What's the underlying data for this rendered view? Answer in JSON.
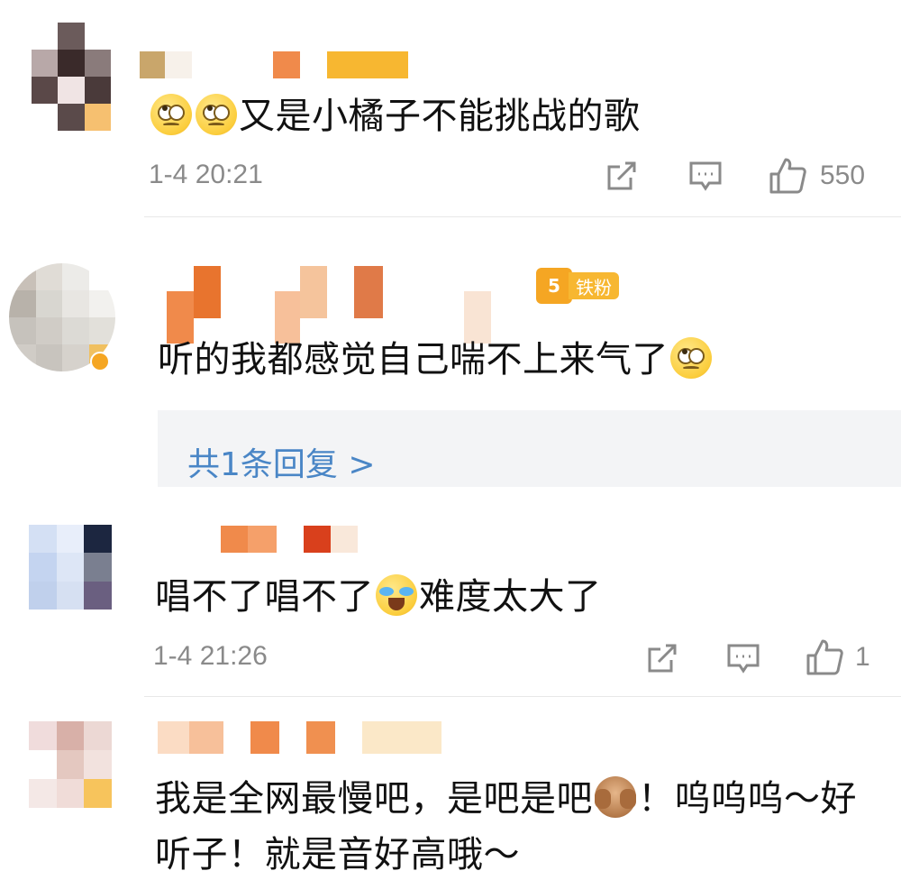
{
  "comments": [
    {
      "text": "又是小橘子不能挑战的歌",
      "time": "1-4 20:21",
      "likes": "550"
    },
    {
      "text": "听的我都感觉自己喘不上来气了",
      "badge": "铁粉",
      "badge_icon_label": "5",
      "reply_link": "共1条回复 >"
    },
    {
      "text_before_emoji": "唱不了唱不了",
      "text_after_emoji": "难度太大了",
      "time": "1-4 21:26",
      "likes": "1"
    },
    {
      "text_line1_before_emoji": "我是全网最慢吧，是吧是吧",
      "text_line1_after_emoji": "！呜呜呜～好",
      "text_line2": "听子！就是音好高哦～"
    }
  ],
  "icons": {
    "share": "share-icon",
    "comment": "comment-icon",
    "like": "thumbs-up-icon"
  },
  "colors": {
    "link": "#4a86c6",
    "meta": "#8a8a8a",
    "badge": "#f5a623"
  }
}
